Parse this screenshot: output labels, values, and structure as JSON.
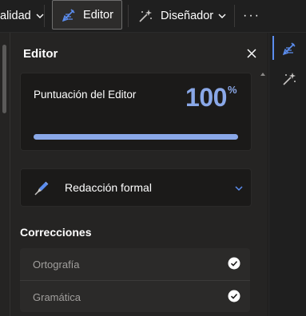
{
  "ribbon": {
    "calidad_label": "alidad",
    "editor_label": "Editor",
    "disenador_label": "Diseñador",
    "more_label": "···"
  },
  "pane": {
    "title": "Editor",
    "score": {
      "label": "Puntuación del Editor",
      "value": "100",
      "unit": "%",
      "fill_fraction": 1.0
    },
    "style": {
      "label": "Redacción formal"
    },
    "corrections": {
      "title": "Correcciones",
      "items": [
        {
          "label": "Ortografía",
          "checked": true
        },
        {
          "label": "Gramática",
          "checked": true
        }
      ]
    }
  },
  "colors": {
    "accent": "#8aa8e8",
    "rail_active": "#5b8def",
    "check_fill": "#ffffff",
    "check_mark": "#1b1a19"
  },
  "icons": [
    "caret-down-icon",
    "editor-pen-icon",
    "designer-wand-icon",
    "more-icon",
    "close-icon",
    "fountain-pen-icon",
    "chevron-down-icon",
    "check-circle-icon"
  ]
}
